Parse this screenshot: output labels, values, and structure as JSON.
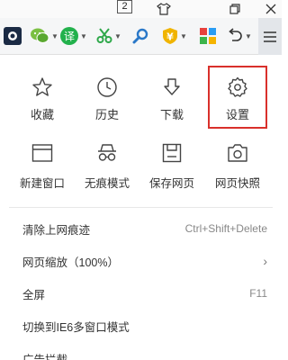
{
  "window": {
    "tab_count": "2",
    "buttons": [
      "shirt-icon",
      "restore-icon",
      "close-icon"
    ]
  },
  "toolbar": {
    "items": [
      {
        "name": "app-logo-icon"
      },
      {
        "name": "wechat-icon",
        "has_dropdown": true
      },
      {
        "name": "translate-icon",
        "glyph": "译",
        "color": "#22b14c",
        "has_dropdown": true
      },
      {
        "name": "scissors-icon",
        "color": "#2ea84a",
        "has_dropdown": true
      },
      {
        "name": "search-icon",
        "color": "#2a78c8"
      },
      {
        "name": "yen-shield-icon",
        "glyph": "¥",
        "color": "#f0b400",
        "has_dropdown": true
      },
      {
        "name": "apps-grid-icon"
      },
      {
        "name": "undo-icon",
        "has_dropdown": true
      },
      {
        "name": "menu-icon"
      }
    ]
  },
  "menu": {
    "quick_actions": [
      {
        "id": "favorites",
        "label": "收藏",
        "icon": "star-icon"
      },
      {
        "id": "history",
        "label": "历史",
        "icon": "clock-icon"
      },
      {
        "id": "downloads",
        "label": "下载",
        "icon": "download-icon"
      },
      {
        "id": "settings",
        "label": "设置",
        "icon": "gear-icon",
        "highlighted": true
      },
      {
        "id": "new-window",
        "label": "新建窗口",
        "icon": "window-icon"
      },
      {
        "id": "incognito",
        "label": "无痕模式",
        "icon": "incognito-icon"
      },
      {
        "id": "save-page",
        "label": "保存网页",
        "icon": "save-icon"
      },
      {
        "id": "screenshot",
        "label": "网页快照",
        "icon": "camera-icon"
      }
    ],
    "items": [
      {
        "label": "清除上网痕迹",
        "shortcut": "Ctrl+Shift+Delete"
      },
      {
        "label": "网页缩放（100%）",
        "submenu": "›"
      },
      {
        "label": "全屏",
        "shortcut": "F11"
      },
      {
        "label": "切换到IE6多窗口模式"
      },
      {
        "label": "广告拦截"
      }
    ],
    "highlight_color": "#d9302b"
  }
}
